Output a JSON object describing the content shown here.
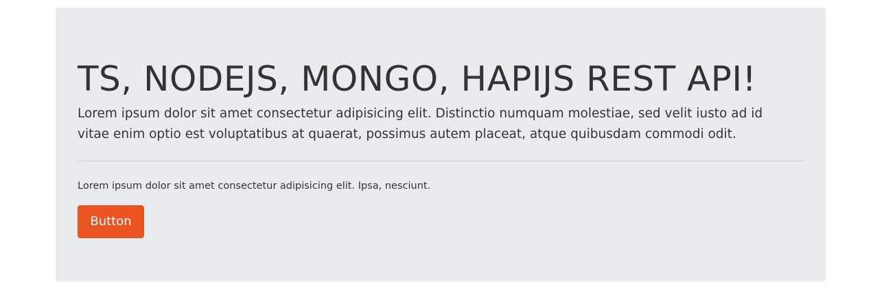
{
  "jumbotron": {
    "title": "TS, NODEJS, MONGO, HAPIJS REST API!",
    "lead": "Lorem ipsum dolor sit amet consectetur adipisicing elit. Distinctio numquam molestiae, sed velit iusto ad id vitae enim optio est voluptatibus at quaerat, possimus autem placeat, atque quibusdam commodi odit.",
    "secondary_text": "Lorem ipsum dolor sit amet consectetur adipisicing elit. Ipsa, nesciunt.",
    "button_label": "Button"
  },
  "colors": {
    "jumbotron_bg": "#e9ecef",
    "button_bg": "#e95420",
    "text": "#333333"
  }
}
